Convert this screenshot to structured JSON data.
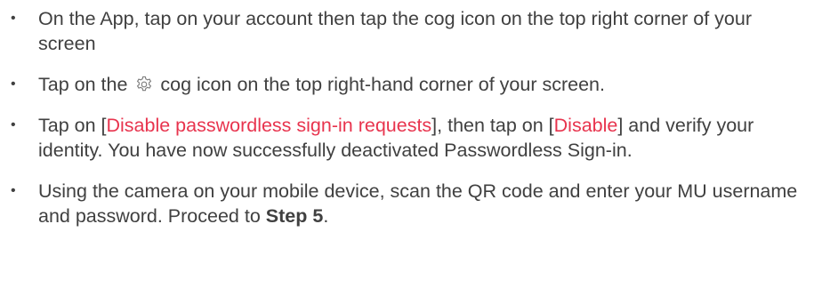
{
  "bullet_char": "•",
  "colors": {
    "text": "#404040",
    "highlight": "#e8344e"
  },
  "steps": [
    {
      "text": "On the App, tap on your account then tap the cog icon on the top right corner of your screen"
    },
    {
      "before_icon": "Tap on the",
      "icon": "cog-icon",
      "after_icon": "cog icon on the top right-hand corner of your screen."
    },
    {
      "part1": "Tap on [",
      "link1": "Disable passwordless sign-in requests",
      "part2": "], then tap on [",
      "link2": "Disable",
      "part3": "] and verify your identity. You have now successfully deactivated Passwordless Sign-in."
    },
    {
      "text": "Using the camera on your mobile device, scan the QR code and enter your MU username and password. Proceed to",
      "bold": "Step 5",
      "end": "."
    }
  ]
}
